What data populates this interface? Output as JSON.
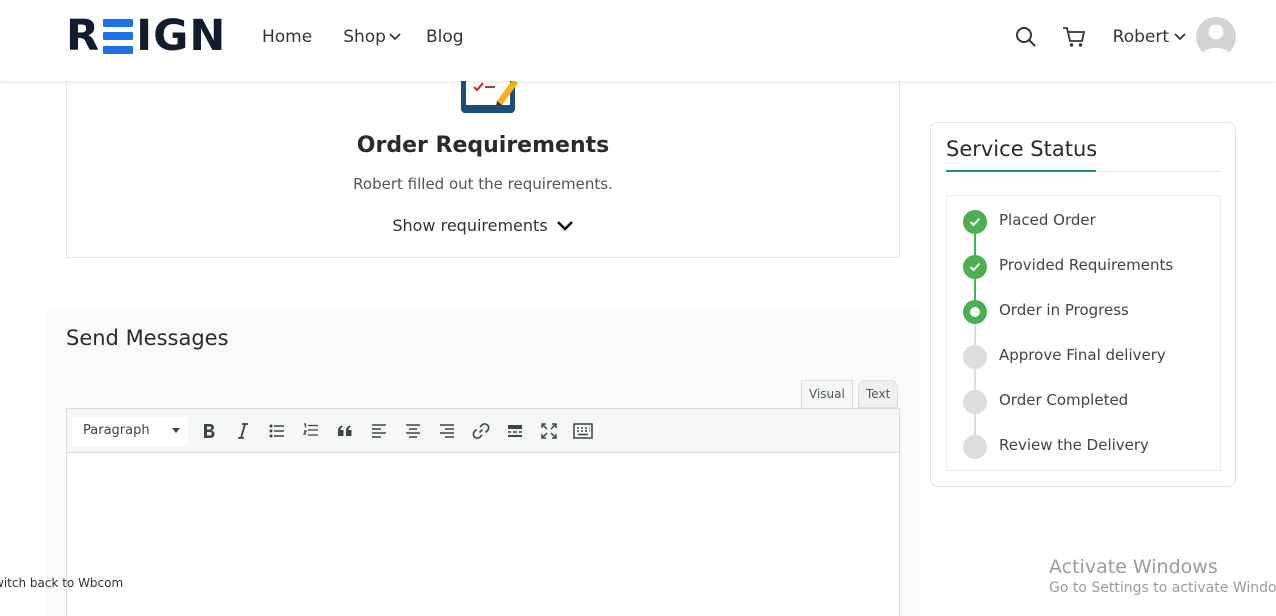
{
  "header": {
    "logo_text": "REIGN",
    "nav": [
      {
        "label": "Home"
      },
      {
        "label": "Shop"
      },
      {
        "label": "Blog"
      }
    ],
    "user_name": "Robert"
  },
  "requirements": {
    "title": "Order Requirements",
    "subtitle": "Robert filled out the requirements.",
    "toggle_label": "Show requirements"
  },
  "messages": {
    "title": "Send Messages",
    "tab_visual": "Visual",
    "tab_text": "Text",
    "format_select_value": "Paragraph",
    "toolbar_icons": [
      "bold-icon",
      "italic-icon",
      "bullet-list-icon",
      "numbered-list-icon",
      "blockquote-icon",
      "align-left-icon",
      "align-center-icon",
      "align-right-icon",
      "link-icon",
      "read-more-icon",
      "fullscreen-icon",
      "toolbar-toggle-icon"
    ]
  },
  "service_status": {
    "title": "Service Status",
    "steps": [
      {
        "label": "Placed Order",
        "state": "done"
      },
      {
        "label": "Provided Requirements",
        "state": "done"
      },
      {
        "label": "Order in Progress",
        "state": "current"
      },
      {
        "label": "Approve Final delivery",
        "state": "pending"
      },
      {
        "label": "Order Completed",
        "state": "pending"
      },
      {
        "label": "Review the Delivery",
        "state": "pending"
      }
    ]
  },
  "watermark": {
    "title": "Activate Windows",
    "subtitle": "Go to Settings to activate Windows."
  },
  "switch_back_label": "witch back to Wbcom",
  "colors": {
    "brand_blue": "#1f6fe6",
    "status_green": "#4caf50",
    "accent_teal": "#1a8f7a",
    "pending_grey": "#dddddd"
  }
}
